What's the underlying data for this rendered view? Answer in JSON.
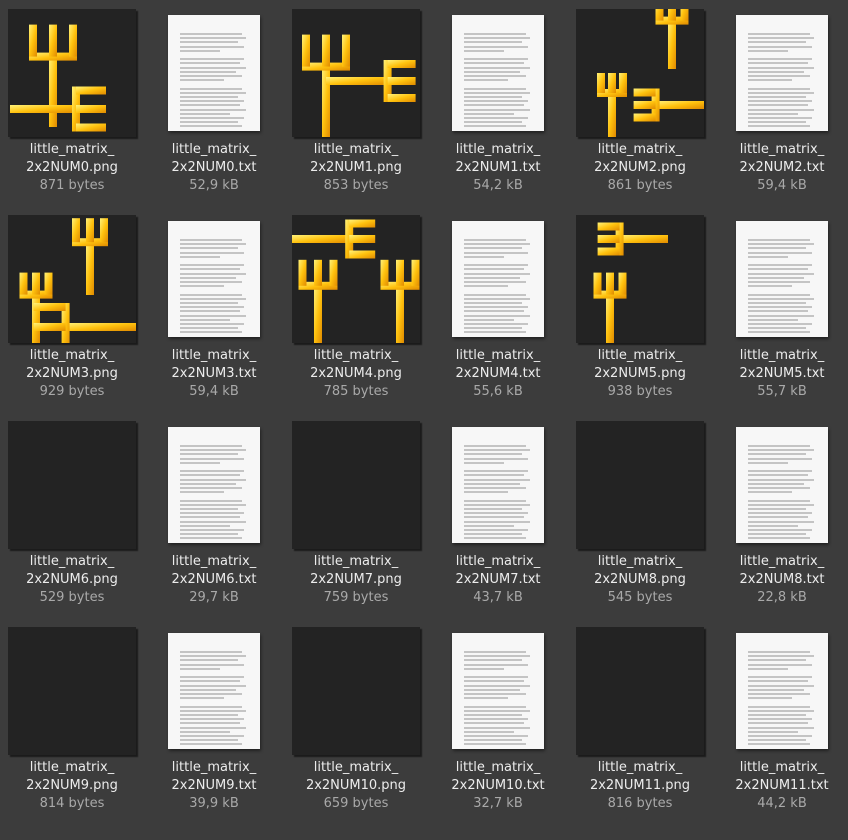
{
  "theme": {
    "background": "#3c3c3c",
    "accent": "#ffc20e",
    "text": "#ececec",
    "muted": "#a9a9a9"
  },
  "files": [
    {
      "name_line1": "little_matrix_",
      "name_line2": "2x2NUM0.png",
      "size": "871 bytes",
      "type": "png",
      "icon": "fork-glyph-image-icon"
    },
    {
      "name_line1": "little_matrix_",
      "name_line2": "2x2NUM0.txt",
      "size": "52,9 kB",
      "type": "txt",
      "icon": "text-document-icon"
    },
    {
      "name_line1": "little_matrix_",
      "name_line2": "2x2NUM1.png",
      "size": "853 bytes",
      "type": "png",
      "icon": "fork-glyph-image-icon"
    },
    {
      "name_line1": "little_matrix_",
      "name_line2": "2x2NUM1.txt",
      "size": "54,2 kB",
      "type": "txt",
      "icon": "text-document-icon"
    },
    {
      "name_line1": "little_matrix_",
      "name_line2": "2x2NUM2.png",
      "size": "861 bytes",
      "type": "png",
      "icon": "fork-glyph-image-icon"
    },
    {
      "name_line1": "little_matrix_",
      "name_line2": "2x2NUM2.txt",
      "size": "59,4 kB",
      "type": "txt",
      "icon": "text-document-icon"
    },
    {
      "name_line1": "little_matrix_",
      "name_line2": "2x2NUM3.png",
      "size": "929 bytes",
      "type": "png",
      "icon": "fork-glyph-image-icon"
    },
    {
      "name_line1": "little_matrix_",
      "name_line2": "2x2NUM3.txt",
      "size": "59,4 kB",
      "type": "txt",
      "icon": "text-document-icon"
    },
    {
      "name_line1": "little_matrix_",
      "name_line2": "2x2NUM4.png",
      "size": "785 bytes",
      "type": "png",
      "icon": "fork-glyph-image-icon"
    },
    {
      "name_line1": "little_matrix_",
      "name_line2": "2x2NUM4.txt",
      "size": "55,6 kB",
      "type": "txt",
      "icon": "text-document-icon"
    },
    {
      "name_line1": "little_matrix_",
      "name_line2": "2x2NUM5.png",
      "size": "938 bytes",
      "type": "png",
      "icon": "fork-glyph-image-icon"
    },
    {
      "name_line1": "little_matrix_",
      "name_line2": "2x2NUM5.txt",
      "size": "55,7 kB",
      "type": "txt",
      "icon": "text-document-icon"
    },
    {
      "name_line1": "little_matrix_",
      "name_line2": "2x2NUM6.png",
      "size": "529 bytes",
      "type": "png",
      "icon": "fork-glyph-image-icon"
    },
    {
      "name_line1": "little_matrix_",
      "name_line2": "2x2NUM6.txt",
      "size": "29,7 kB",
      "type": "txt",
      "icon": "text-document-icon"
    },
    {
      "name_line1": "little_matrix_",
      "name_line2": "2x2NUM7.png",
      "size": "759 bytes",
      "type": "png",
      "icon": "fork-glyph-image-icon"
    },
    {
      "name_line1": "little_matrix_",
      "name_line2": "2x2NUM7.txt",
      "size": "43,7 kB",
      "type": "txt",
      "icon": "text-document-icon"
    },
    {
      "name_line1": "little_matrix_",
      "name_line2": "2x2NUM8.png",
      "size": "545 bytes",
      "type": "png",
      "icon": "fork-glyph-image-icon"
    },
    {
      "name_line1": "little_matrix_",
      "name_line2": "2x2NUM8.txt",
      "size": "22,8 kB",
      "type": "txt",
      "icon": "text-document-icon"
    },
    {
      "name_line1": "little_matrix_",
      "name_line2": "2x2NUM9.png",
      "size": "814 bytes",
      "type": "png",
      "icon": "fork-glyph-image-icon"
    },
    {
      "name_line1": "little_matrix_",
      "name_line2": "2x2NUM9.txt",
      "size": "39,9 kB",
      "type": "txt",
      "icon": "text-document-icon"
    },
    {
      "name_line1": "little_matrix_",
      "name_line2": "2x2NUM10.png",
      "size": "659 bytes",
      "type": "png",
      "icon": "fork-glyph-image-icon"
    },
    {
      "name_line1": "little_matrix_",
      "name_line2": "2x2NUM10.txt",
      "size": "32,7 kB",
      "type": "txt",
      "icon": "text-document-icon"
    },
    {
      "name_line1": "little_matrix_",
      "name_line2": "2x2NUM11.png",
      "size": "816 bytes",
      "type": "png",
      "icon": "fork-glyph-image-icon"
    },
    {
      "name_line1": "little_matrix_",
      "name_line2": "2x2NUM11.txt",
      "size": "44,2 kB",
      "type": "txt",
      "icon": "text-document-icon"
    }
  ]
}
